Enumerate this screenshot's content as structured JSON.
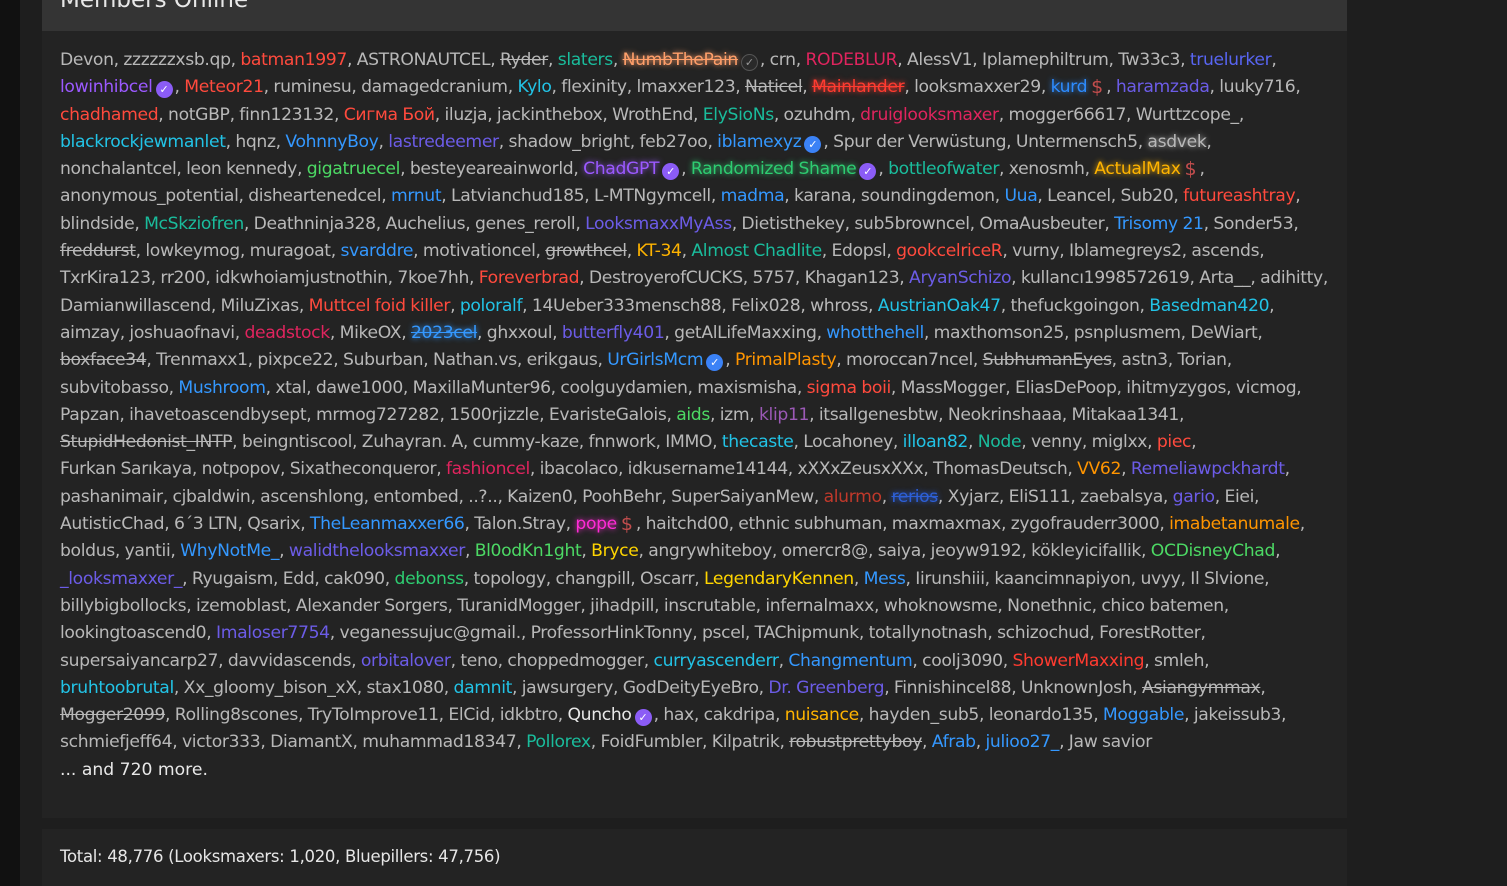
{
  "panel": {
    "title": "Members Online",
    "and_more": "... and 720 more.",
    "total": "Total: 48,776 (Looksmaxers: 1,020, Bluepillers: 47,756)"
  },
  "members": [
    {
      "n": "Devon"
    },
    {
      "n": "zzzzzzxsb.qp"
    },
    {
      "n": "batman1997",
      "c": "#ff4a3d"
    },
    {
      "n": "ASTRONAUTCEL"
    },
    {
      "n": "Ryder",
      "s": true
    },
    {
      "n": "slaters",
      "c": "#1abc9c"
    },
    {
      "n": "NumbThePain",
      "c": "#ff9f6a",
      "g": true,
      "s": true,
      "b": "dark"
    },
    {
      "n": "crn"
    },
    {
      "n": "RODEBLUR",
      "c": "#e0245e"
    },
    {
      "n": "AlessV1"
    },
    {
      "n": "Iplamephiltrum"
    },
    {
      "n": "Tw33c3"
    },
    {
      "n": "truelurker",
      "c": "#5865f2"
    },
    {
      "n": "lowinhibcel",
      "c": "#9b59ff",
      "b": "purple"
    },
    {
      "n": "Meteor21",
      "c": "#ff4a3d"
    },
    {
      "n": "ruminesu"
    },
    {
      "n": "damagedcranium"
    },
    {
      "n": "Kylo",
      "c": "#22c3e6"
    },
    {
      "n": "flexinity"
    },
    {
      "n": "lmaxxer123"
    },
    {
      "n": "Naticel",
      "s": true
    },
    {
      "n": "Mainlander",
      "c": "#ff3b30",
      "g": true,
      "s": true
    },
    {
      "n": "looksmaxxer29"
    },
    {
      "n": "kurd",
      "c": "#2d8cff",
      "g": true,
      "b": "dollar"
    },
    {
      "n": "haramzada",
      "c": "#6c5ce7"
    },
    {
      "n": "luuky716"
    },
    {
      "n": "chadhamed",
      "c": "#ff4a3d"
    },
    {
      "n": "notGBP"
    },
    {
      "n": "finn123132"
    },
    {
      "n": "Сигма Бой",
      "c": "#ff4a3d"
    },
    {
      "n": "iluzja"
    },
    {
      "n": "jackinthebox"
    },
    {
      "n": "WrothEnd"
    },
    {
      "n": "ElySioNs",
      "c": "#1abc9c"
    },
    {
      "n": "ozuhdm"
    },
    {
      "n": "druiglooksmaxer",
      "c": "#e0245e"
    },
    {
      "n": "mogger66617"
    },
    {
      "n": "Wurttzcope_"
    },
    {
      "n": "blackrockjewmanlet",
      "c": "#22c3e6"
    },
    {
      "n": "hqnz"
    },
    {
      "n": "VohnnyBoy",
      "c": "#3498ff"
    },
    {
      "n": "lastredeemer",
      "c": "#6c5ce7"
    },
    {
      "n": "shadow_bright"
    },
    {
      "n": "feb27oo"
    },
    {
      "n": "iblamexyz",
      "c": "#3498ff",
      "b": "blue"
    },
    {
      "n": "Spur der Verwüstung"
    },
    {
      "n": "Untermensch5"
    },
    {
      "n": "asdvek",
      "g": true
    },
    {
      "n": "nonchalantcel"
    },
    {
      "n": "leon kennedy"
    },
    {
      "n": "gigatruecel",
      "c": "#4cd964"
    },
    {
      "n": "besteyeareainworld"
    },
    {
      "n": "ChadGPT",
      "c": "#9b59ff",
      "g": true,
      "b": "purple"
    },
    {
      "n": "Randomized Shame",
      "c": "#2ecc71",
      "g": true,
      "b": "purple"
    },
    {
      "n": "bottleofwater",
      "c": "#1abc9c"
    },
    {
      "n": "xenosmh"
    },
    {
      "n": "ActualMax",
      "c": "#ffb400",
      "g": true,
      "b": "dollar"
    },
    {
      "n": "anonymous_potential"
    },
    {
      "n": "disheartenedcel"
    },
    {
      "n": "mrnut",
      "c": "#3498ff"
    },
    {
      "n": "Latvianchud185"
    },
    {
      "n": "L-MTNgymcell"
    },
    {
      "n": "madma",
      "c": "#3498ff"
    },
    {
      "n": "karana"
    },
    {
      "n": "soundingdemon"
    },
    {
      "n": "Uua",
      "c": "#3498ff"
    },
    {
      "n": "Leancel"
    },
    {
      "n": "Sub20"
    },
    {
      "n": "futureashtray",
      "c": "#ff4a3d"
    },
    {
      "n": "blindside"
    },
    {
      "n": "McSkziofren",
      "c": "#1abc9c"
    },
    {
      "n": "Deathninja328"
    },
    {
      "n": "Auchelius"
    },
    {
      "n": "genes_reroll"
    },
    {
      "n": "LooksmaxxMyAss",
      "c": "#6c5ce7"
    },
    {
      "n": "Dietisthekey"
    },
    {
      "n": "sub5browncel"
    },
    {
      "n": "OmaAusbeuter"
    },
    {
      "n": "Trisomy 21",
      "c": "#3498ff"
    },
    {
      "n": "Sonder53"
    },
    {
      "n": "freddurst",
      "s": true
    },
    {
      "n": "lowkeymog"
    },
    {
      "n": "muragoat"
    },
    {
      "n": "svarddre",
      "c": "#3498ff"
    },
    {
      "n": "motivationcel"
    },
    {
      "n": "growthcel",
      "s": true
    },
    {
      "n": "KT-34",
      "c": "#ffb400"
    },
    {
      "n": "Almost Chadlite",
      "c": "#1abc9c"
    },
    {
      "n": "Edopsl"
    },
    {
      "n": "gookcelriceR",
      "c": "#ff4a3d"
    },
    {
      "n": "vurny"
    },
    {
      "n": "Iblamegreys2"
    },
    {
      "n": "ascends"
    },
    {
      "n": "TxrKira123"
    },
    {
      "n": "rr200"
    },
    {
      "n": "idkwhoiamjustnothin"
    },
    {
      "n": "7koe7hh"
    },
    {
      "n": "Foreverbrad",
      "c": "#ff4a3d"
    },
    {
      "n": "DestroyerofCUCKS"
    },
    {
      "n": "5757"
    },
    {
      "n": "Khagan123"
    },
    {
      "n": "AryanSchizo",
      "c": "#6c5ce7"
    },
    {
      "n": "kullancı1998572619"
    },
    {
      "n": "Arta__"
    },
    {
      "n": "adihitty"
    },
    {
      "n": "Damianwillascend"
    },
    {
      "n": "MiluZixas"
    },
    {
      "n": "Muttcel foid killer",
      "c": "#ff4a3d"
    },
    {
      "n": "poloralf",
      "c": "#22c3e6"
    },
    {
      "n": "14Ueber333mensch88"
    },
    {
      "n": "Felix028"
    },
    {
      "n": "whross"
    },
    {
      "n": "AustrianOak47",
      "c": "#22c3e6"
    },
    {
      "n": "thefuckgoingon"
    },
    {
      "n": "Basedman420",
      "c": "#22c3e6"
    },
    {
      "n": "aimzay"
    },
    {
      "n": "joshuaofnavi"
    },
    {
      "n": "deadstock",
      "c": "#e0245e"
    },
    {
      "n": "MikeOX"
    },
    {
      "n": "2023cel",
      "c": "#3498ff",
      "g": true,
      "s": true
    },
    {
      "n": "ghxxoul"
    },
    {
      "n": "butterfly401",
      "c": "#6c5ce7"
    },
    {
      "n": "getAlLifeMaxxing"
    },
    {
      "n": "whotthehell",
      "c": "#3498ff"
    },
    {
      "n": "maxthomson25"
    },
    {
      "n": "psnplusmem"
    },
    {
      "n": "DeWiart"
    },
    {
      "n": "boxface34",
      "s": true
    },
    {
      "n": "Trenmaxx1"
    },
    {
      "n": "pixpce22"
    },
    {
      "n": "Suburban"
    },
    {
      "n": "Nathan.vs"
    },
    {
      "n": "erikgaus"
    },
    {
      "n": "UrGirlsMcm",
      "c": "#3498ff",
      "b": "blue"
    },
    {
      "n": "PrimalPlasty",
      "c": "#ff9500"
    },
    {
      "n": "moroccan7ncel"
    },
    {
      "n": "SubhumanEyes",
      "s": true
    },
    {
      "n": "astn3"
    },
    {
      "n": "Torian"
    },
    {
      "n": "subvitobasso"
    },
    {
      "n": "Mushroom",
      "c": "#3498ff"
    },
    {
      "n": "xtal"
    },
    {
      "n": "dawe1000"
    },
    {
      "n": "MaxillaMunter96"
    },
    {
      "n": "coolguydamien"
    },
    {
      "n": "maxismisha"
    },
    {
      "n": "sigma boii",
      "c": "#ff4a3d"
    },
    {
      "n": "MassMogger"
    },
    {
      "n": "EliasDePoop"
    },
    {
      "n": "ihitmyzygos"
    },
    {
      "n": "vicmog"
    },
    {
      "n": "Papzan"
    },
    {
      "n": "ihavetoascendbysept"
    },
    {
      "n": "mrmog727282"
    },
    {
      "n": "1500rjizzle"
    },
    {
      "n": "EvaristeGalois"
    },
    {
      "n": "aids",
      "c": "#4cd964"
    },
    {
      "n": "izm"
    },
    {
      "n": "klip11",
      "c": "#9b59b6"
    },
    {
      "n": "itsallgenesbtw"
    },
    {
      "n": "Neokrinshaaa"
    },
    {
      "n": "Mitakaa1341"
    },
    {
      "n": "StupidHedonist_INTP",
      "s": true
    },
    {
      "n": "beingntiscool"
    },
    {
      "n": "Zuhayran. A"
    },
    {
      "n": "cummy-kaze"
    },
    {
      "n": "fnnwork"
    },
    {
      "n": "IMMO"
    },
    {
      "n": "thecaste",
      "c": "#22c3e6"
    },
    {
      "n": "Locahoney"
    },
    {
      "n": "illoan82",
      "c": "#22c3e6"
    },
    {
      "n": "Node",
      "c": "#1abc9c"
    },
    {
      "n": "venny"
    },
    {
      "n": "miglxx"
    },
    {
      "n": "piec",
      "c": "#ff4a3d"
    },
    {
      "n": "Furkan Sarıkaya"
    },
    {
      "n": "notpopov"
    },
    {
      "n": "Sixatheconqueror"
    },
    {
      "n": "fashioncel",
      "c": "#e0245e"
    },
    {
      "n": "ibacolaco"
    },
    {
      "n": "idkusername14144"
    },
    {
      "n": "xXXxZeusxXXx"
    },
    {
      "n": "ThomasDeutsch"
    },
    {
      "n": "VV62",
      "c": "#ff9500"
    },
    {
      "n": "Remeliawpckhardt",
      "c": "#6c5ce7"
    },
    {
      "n": "pashanimair"
    },
    {
      "n": "cjbaldwin"
    },
    {
      "n": "ascenshlong"
    },
    {
      "n": "entombed"
    },
    {
      "n": "..?.."
    },
    {
      "n": "Kaizen0"
    },
    {
      "n": "PoohBehr"
    },
    {
      "n": "SuperSaiyanMew"
    },
    {
      "n": "alurmo",
      "c": "#c0392b"
    },
    {
      "n": "rerios",
      "c": "#2d5fd6",
      "g": true,
      "s": true
    },
    {
      "n": "Xyjarz"
    },
    {
      "n": "EliS111"
    },
    {
      "n": "zaebalsya"
    },
    {
      "n": "gario",
      "c": "#6c5ce7"
    },
    {
      "n": "Eiei"
    },
    {
      "n": "AutisticChad"
    },
    {
      "n": "6´3 LTN"
    },
    {
      "n": "Qsarix"
    },
    {
      "n": "TheLeanmaxxer66",
      "c": "#3498ff"
    },
    {
      "n": "Talon.Stray"
    },
    {
      "n": "pope",
      "c": "#ff2bd6",
      "g": true,
      "b": "dollar"
    },
    {
      "n": "haitchd00"
    },
    {
      "n": "ethnic subhuman"
    },
    {
      "n": "maxmaxmax"
    },
    {
      "n": "zygofrauderr3000"
    },
    {
      "n": "imabetanumale",
      "c": "#ff9500"
    },
    {
      "n": "boldus"
    },
    {
      "n": "yantii"
    },
    {
      "n": "WhyNotMe_",
      "c": "#3498ff"
    },
    {
      "n": "walidthelooksmaxxer",
      "c": "#6c5ce7"
    },
    {
      "n": "Bl0odKn1ght",
      "c": "#4cd964"
    },
    {
      "n": "Bryce",
      "c": "#ffd500"
    },
    {
      "n": "angrywhiteboy"
    },
    {
      "n": "omercr8@"
    },
    {
      "n": "saiya"
    },
    {
      "n": "jeoyw9192"
    },
    {
      "n": "kökleyicifallik"
    },
    {
      "n": "OCDisneyChad",
      "c": "#4cd964"
    },
    {
      "n": "_looksmaxxer_",
      "c": "#6c5ce7"
    },
    {
      "n": "Ryugaism"
    },
    {
      "n": "Edd"
    },
    {
      "n": "cak090"
    },
    {
      "n": "debonss",
      "c": "#2ecc71"
    },
    {
      "n": "topology"
    },
    {
      "n": "changpill"
    },
    {
      "n": "Oscarr"
    },
    {
      "n": "LegendaryKennen",
      "c": "#ffd500"
    },
    {
      "n": "Mess",
      "c": "#3498ff"
    },
    {
      "n": "Iirunshiii"
    },
    {
      "n": "kaancimnapiyon"
    },
    {
      "n": "uvyy"
    },
    {
      "n": "Il Slvione"
    },
    {
      "n": "billybigbollocks"
    },
    {
      "n": "izemoblast"
    },
    {
      "n": "Alexander Sorgers"
    },
    {
      "n": "TuranidMogger"
    },
    {
      "n": "jihadpill"
    },
    {
      "n": "inscrutable"
    },
    {
      "n": "infernalmaxx"
    },
    {
      "n": "whoknowsme"
    },
    {
      "n": "Nonethnic"
    },
    {
      "n": "chico batemen"
    },
    {
      "n": "lookingtoascend0"
    },
    {
      "n": "Imaloser7754",
      "c": "#6c5ce7"
    },
    {
      "n": "veganessujuc@gmail."
    },
    {
      "n": "ProfessorHinkTonny"
    },
    {
      "n": "pscel"
    },
    {
      "n": "TAChipmunk"
    },
    {
      "n": "totallynotnash"
    },
    {
      "n": "schizochud"
    },
    {
      "n": "ForestRotter"
    },
    {
      "n": "supersaiyancarp27"
    },
    {
      "n": "davvidascends"
    },
    {
      "n": "orbitalover",
      "c": "#6c5ce7"
    },
    {
      "n": "teno"
    },
    {
      "n": "choppedmogger"
    },
    {
      "n": "curryascenderr",
      "c": "#22c3e6"
    },
    {
      "n": "Changmentum",
      "c": "#3498ff"
    },
    {
      "n": "coolj3090"
    },
    {
      "n": "ShowerMaxxing",
      "c": "#ff3b30"
    },
    {
      "n": "smleh"
    },
    {
      "n": "bruhtoobrutal",
      "c": "#22c3e6"
    },
    {
      "n": "Xx_gloomy_bison_xX"
    },
    {
      "n": "stax1080"
    },
    {
      "n": "damnit",
      "c": "#22c3e6"
    },
    {
      "n": "jawsurgery"
    },
    {
      "n": "GodDeityEyeBro"
    },
    {
      "n": "Dr. Greenberg",
      "c": "#6c5ce7"
    },
    {
      "n": "Finnishincel88"
    },
    {
      "n": "UnknownJosh"
    },
    {
      "n": "Asiangymmax",
      "s": true
    },
    {
      "n": "Mogger2099",
      "s": true
    },
    {
      "n": "Rolling8scones"
    },
    {
      "n": "TryToImprove11"
    },
    {
      "n": "ElCid"
    },
    {
      "n": "idkbtro"
    },
    {
      "n": "Quncho",
      "c": "#e8e8e8",
      "b": "purple"
    },
    {
      "n": "hax"
    },
    {
      "n": "cakdripa"
    },
    {
      "n": "nuisance",
      "c": "#ffb400"
    },
    {
      "n": "hayden_sub5"
    },
    {
      "n": "leonardo135"
    },
    {
      "n": "Moggable",
      "c": "#3498ff"
    },
    {
      "n": "jakeissub3"
    },
    {
      "n": "schmiefjeff64"
    },
    {
      "n": "victor333"
    },
    {
      "n": "DiamantX"
    },
    {
      "n": "muhammad18347"
    },
    {
      "n": "Pollorex",
      "c": "#1abc9c"
    },
    {
      "n": "FoidFumbler"
    },
    {
      "n": "Kilpatrik"
    },
    {
      "n": "robustprettyboy",
      "s": true
    },
    {
      "n": "Afrab",
      "c": "#3498ff"
    },
    {
      "n": "julioo27_",
      "c": "#3498ff"
    },
    {
      "n": "Jaw savior"
    }
  ]
}
